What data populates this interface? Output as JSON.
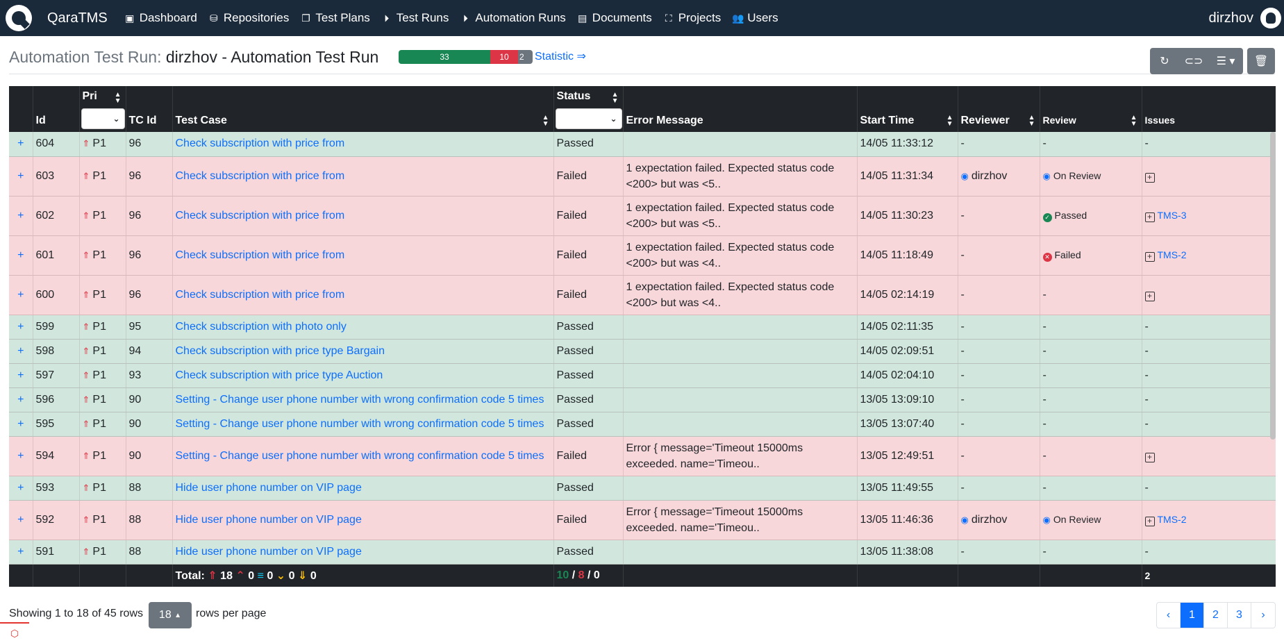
{
  "navbar": {
    "brand": "QaraTMS",
    "items": [
      {
        "label": "Dashboard",
        "icon": "dashboard-icon"
      },
      {
        "label": "Repositories",
        "icon": "database-icon"
      },
      {
        "label": "Test Plans",
        "icon": "documents-icon"
      },
      {
        "label": "Test Runs",
        "icon": "play-circle-icon"
      },
      {
        "label": "Automation Runs",
        "icon": "play-circle-icon"
      },
      {
        "label": "Documents",
        "icon": "file-icon"
      },
      {
        "label": "Projects",
        "icon": "sitemap-icon"
      },
      {
        "label": "Users",
        "icon": "users-icon"
      }
    ],
    "user": "dirzhov"
  },
  "header": {
    "title_prefix": "Automation Test Run:",
    "title": "dirzhov - Automation Test Run",
    "progress": {
      "passed": 33,
      "failed": 10,
      "other": 2
    },
    "statistic_link": "Statistic ⇒"
  },
  "table": {
    "columns": {
      "id": "Id",
      "pri": "Pri",
      "tc_id": "TC Id",
      "test_case": "Test Case",
      "status": "Status",
      "error": "Error Message",
      "start": "Start Time",
      "reviewer": "Reviewer",
      "review": "Review",
      "issues": "Issues"
    },
    "rows": [
      {
        "id": "604",
        "pri": "P1",
        "tc": "96",
        "name": "Check subscription with price from",
        "status": "Passed",
        "error": "",
        "start": "14/05 11:33:12",
        "reviewer": "-",
        "review": "-",
        "issues": "-",
        "result": "pass"
      },
      {
        "id": "603",
        "pri": "P1",
        "tc": "96",
        "name": "Check subscription with price from",
        "status": "Failed",
        "error": "1 expectation failed. Expected status code <200> but was <5..",
        "start": "14/05 11:31:34",
        "reviewer": "dirzhov",
        "review": "On Review",
        "issues": "",
        "result": "fail"
      },
      {
        "id": "602",
        "pri": "P1",
        "tc": "96",
        "name": "Check subscription with price from",
        "status": "Failed",
        "error": "1 expectation failed. Expected status code <200> but was <5..",
        "start": "14/05 11:30:23",
        "reviewer": "-",
        "review": "Passed",
        "issues": "TMS-3",
        "result": "fail"
      },
      {
        "id": "601",
        "pri": "P1",
        "tc": "96",
        "name": "Check subscription with price from",
        "status": "Failed",
        "error": "1 expectation failed. Expected status code <200> but was <4..",
        "start": "14/05 11:18:49",
        "reviewer": "-",
        "review": "Failed",
        "issues": "TMS-2",
        "result": "fail"
      },
      {
        "id": "600",
        "pri": "P1",
        "tc": "96",
        "name": "Check subscription with price from",
        "status": "Failed",
        "error": "1 expectation failed. Expected status code <200> but was <4..",
        "start": "14/05 02:14:19",
        "reviewer": "-",
        "review": "-",
        "issues": "",
        "result": "fail"
      },
      {
        "id": "599",
        "pri": "P1",
        "tc": "95",
        "name": "Check subscription with photo only",
        "status": "Passed",
        "error": "",
        "start": "14/05 02:11:35",
        "reviewer": "-",
        "review": "-",
        "issues": "-",
        "result": "pass"
      },
      {
        "id": "598",
        "pri": "P1",
        "tc": "94",
        "name": "Check subscription with price type Bargain",
        "status": "Passed",
        "error": "",
        "start": "14/05 02:09:51",
        "reviewer": "-",
        "review": "-",
        "issues": "-",
        "result": "pass"
      },
      {
        "id": "597",
        "pri": "P1",
        "tc": "93",
        "name": "Check subscription with price type Auction",
        "status": "Passed",
        "error": "",
        "start": "14/05 02:04:10",
        "reviewer": "-",
        "review": "-",
        "issues": "-",
        "result": "pass"
      },
      {
        "id": "596",
        "pri": "P1",
        "tc": "90",
        "name": "Setting - Change user phone number with wrong confirmation code 5 times",
        "status": "Passed",
        "error": "",
        "start": "13/05 13:09:10",
        "reviewer": "-",
        "review": "-",
        "issues": "-",
        "result": "pass"
      },
      {
        "id": "595",
        "pri": "P1",
        "tc": "90",
        "name": "Setting - Change user phone number with wrong confirmation code 5 times",
        "status": "Passed",
        "error": "",
        "start": "13/05 13:07:40",
        "reviewer": "-",
        "review": "-",
        "issues": "-",
        "result": "pass"
      },
      {
        "id": "594",
        "pri": "P1",
        "tc": "90",
        "name": "Setting - Change user phone number with wrong confirmation code 5 times",
        "status": "Failed",
        "error": "Error { message='Timeout 15000ms exceeded. name='Timeou..",
        "start": "13/05 12:49:51",
        "reviewer": "-",
        "review": "-",
        "issues": "",
        "result": "fail"
      },
      {
        "id": "593",
        "pri": "P1",
        "tc": "88",
        "name": "Hide user phone number on VIP page",
        "status": "Passed",
        "error": "",
        "start": "13/05 11:49:55",
        "reviewer": "-",
        "review": "-",
        "issues": "-",
        "result": "pass"
      },
      {
        "id": "592",
        "pri": "P1",
        "tc": "88",
        "name": "Hide user phone number on VIP page",
        "status": "Failed",
        "error": "Error { message='Timeout 15000ms exceeded. name='Timeou..",
        "start": "13/05 11:46:36",
        "reviewer": "dirzhov",
        "review": "On Review",
        "issues": "TMS-2",
        "result": "fail"
      },
      {
        "id": "591",
        "pri": "P1",
        "tc": "88",
        "name": "Hide user phone number on VIP page",
        "status": "Passed",
        "error": "",
        "start": "13/05 11:38:08",
        "reviewer": "-",
        "review": "-",
        "issues": "-",
        "result": "pass"
      }
    ],
    "footer": {
      "total_label": "Total:",
      "p_counts": [
        "18",
        "0",
        "0",
        "0",
        "0"
      ],
      "status_passed": "10",
      "status_failed": "8",
      "status_other": "0",
      "sep": "/",
      "issues_total": "2"
    }
  },
  "pagination": {
    "showing": "Showing 1 to 18 of 45 rows",
    "rows_per_page": "18",
    "rows_per_page_label": "rows per page",
    "pages": [
      "‹",
      "1",
      "2",
      "3",
      "›"
    ],
    "active_page": "1"
  }
}
